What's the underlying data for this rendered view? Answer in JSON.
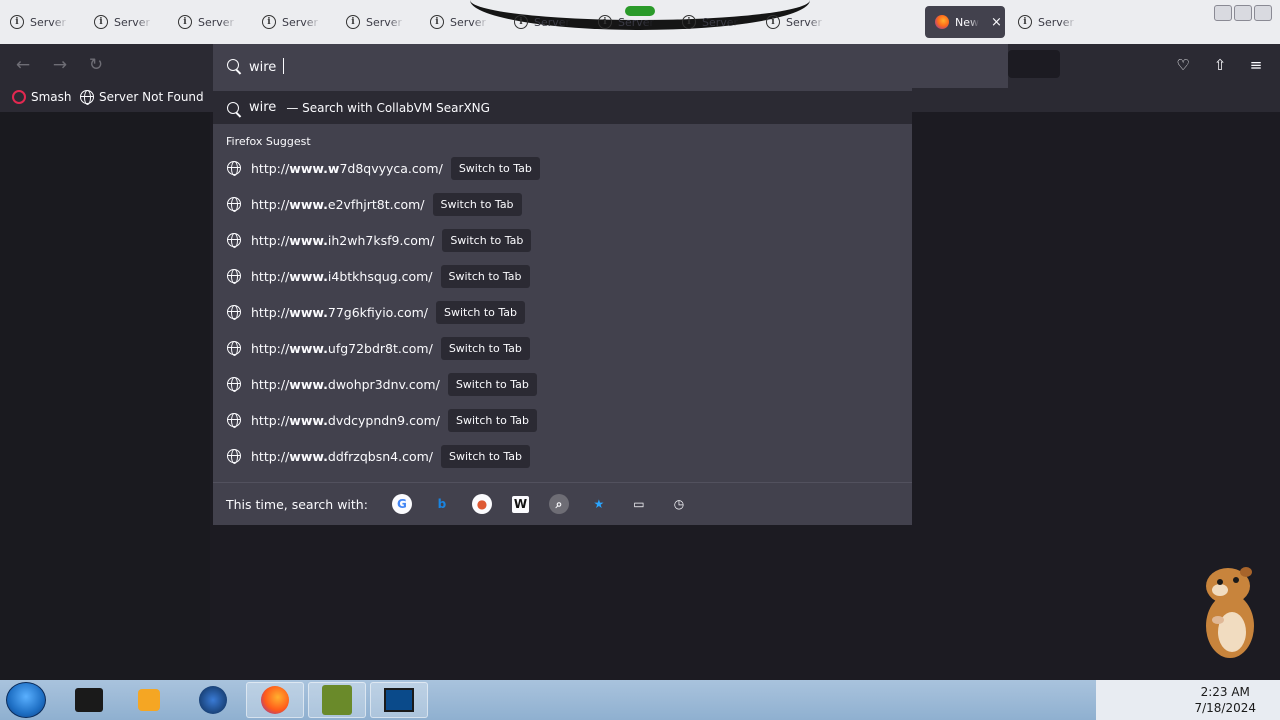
{
  "tabs": [
    {
      "label": "Server Not Found"
    },
    {
      "label": "Server Not Found"
    },
    {
      "label": "Server Not Found"
    },
    {
      "label": "Server Not Found"
    },
    {
      "label": "Server Not Found"
    },
    {
      "label": "Server Not Found"
    },
    {
      "label": "Server Not Found"
    },
    {
      "label": "Server Not Found"
    },
    {
      "label": "Server Not Found"
    },
    {
      "label": "Server Not Found"
    },
    {
      "label": "Server Not Found"
    }
  ],
  "active_tab": {
    "label": "New Tab",
    "close": "×"
  },
  "toolbar": {
    "back": "←",
    "forward": "→",
    "reload": "↻",
    "pocket": "♡",
    "extensions": "⇧",
    "menu": "≡"
  },
  "bookmarks": [
    {
      "label": "Smash"
    },
    {
      "label": "Server Not Found"
    }
  ],
  "urlbar": {
    "value": "wire "
  },
  "popup": {
    "search_term": "wire",
    "search_with": "— Search with CollabVM SearXNG",
    "heading": "Firefox Suggest",
    "switch_label": "Switch to Tab",
    "results": [
      {
        "prefix": "http://",
        "bold": "www.w",
        "rest": "7d8qvyyca.com/"
      },
      {
        "prefix": "http://",
        "bold": "www.",
        "rest": "e2vfhjrt8t.com/"
      },
      {
        "prefix": "http://",
        "bold": "www.",
        "rest": "ih2wh7ksf9.com/"
      },
      {
        "prefix": "http://",
        "bold": "www.",
        "rest": "i4btkhsqug.com/"
      },
      {
        "prefix": "http://",
        "bold": "www.",
        "rest": "77g6kfiyio.com/"
      },
      {
        "prefix": "http://",
        "bold": "www.",
        "rest": "ufg72bdr8t.com/"
      },
      {
        "prefix": "http://",
        "bold": "www.",
        "rest": "dwohpr3dnv.com/"
      },
      {
        "prefix": "http://",
        "bold": "www.",
        "rest": "dvdcypndn9.com/"
      },
      {
        "prefix": "http://",
        "bold": "www.",
        "rest": "ddfrzqbsn4.com/"
      }
    ],
    "footer_label": "This time, search with:",
    "engines": [
      {
        "name": "google-icon",
        "glyph": "G",
        "color": "#4285f4"
      },
      {
        "name": "bing-icon",
        "glyph": "b",
        "color": "#1a84e0"
      },
      {
        "name": "duckduckgo-icon",
        "glyph": "●",
        "color": "#de5833"
      },
      {
        "name": "wikipedia-icon",
        "glyph": "W",
        "color": "#111111"
      },
      {
        "name": "searxng-icon",
        "glyph": "⌕",
        "color": "#9a9aa2"
      },
      {
        "name": "bookmarks-star-icon",
        "glyph": "★",
        "color": "#2aa5ff"
      },
      {
        "name": "tabs-icon",
        "glyph": "▭",
        "color": "#fbfbfe"
      },
      {
        "name": "history-icon",
        "glyph": "◷",
        "color": "#fbfbfe"
      }
    ]
  },
  "clock": {
    "time": "2:23 AM",
    "date": "7/18/2024"
  }
}
